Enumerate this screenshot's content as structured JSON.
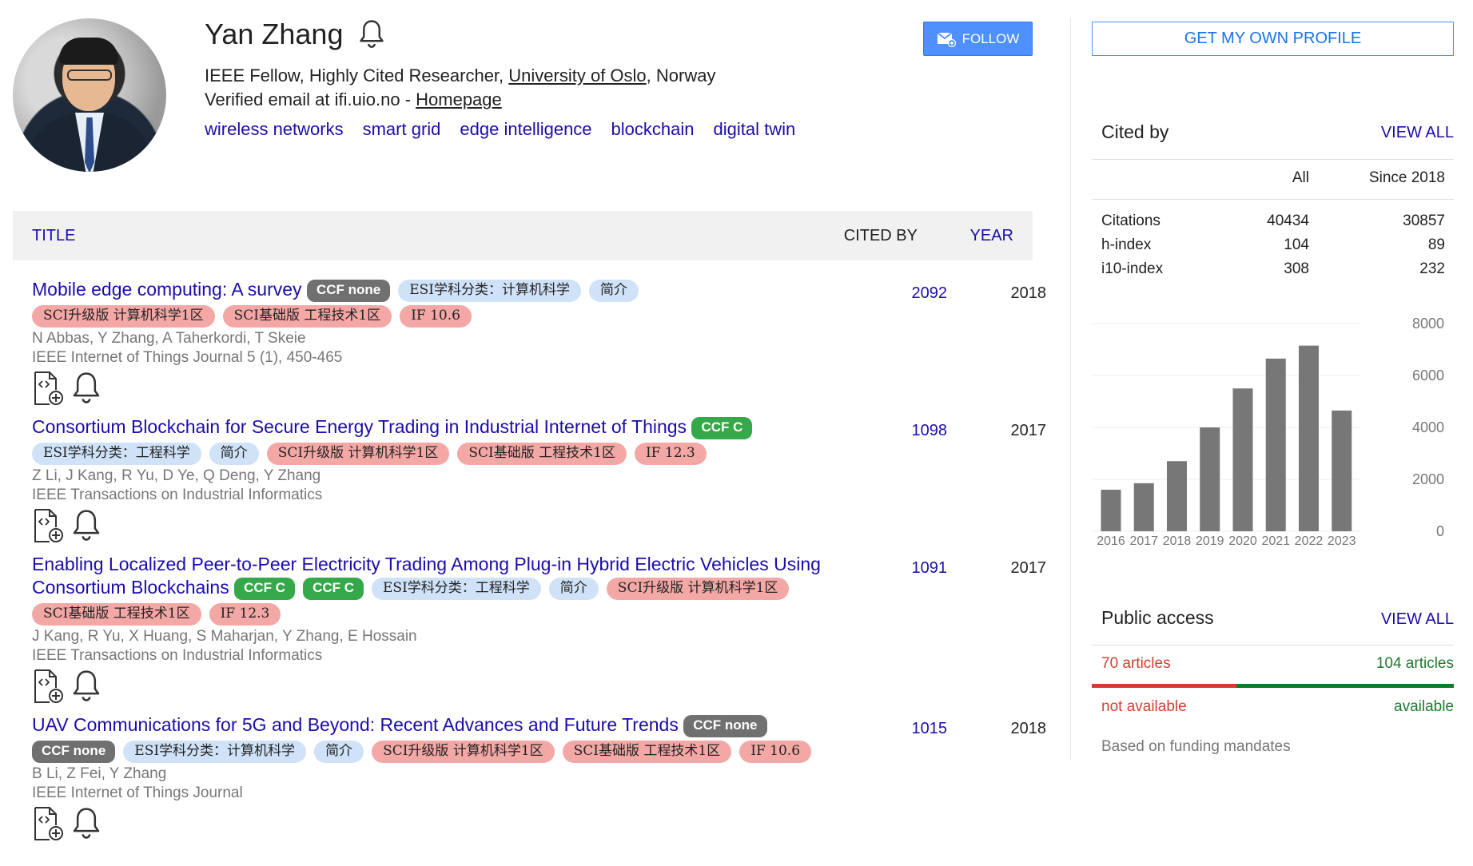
{
  "profile": {
    "name": "Yan Zhang",
    "affiliation_prefix": "IEEE Fellow, Highly Cited Researcher, ",
    "affiliation_link": "University of Oslo",
    "affiliation_suffix": ", Norway",
    "email_text": "Verified email at ifi.uio.no - ",
    "homepage_label": "Homepage",
    "interests": [
      "wireless networks",
      "smart grid",
      "edge intelligence",
      "blockchain",
      "digital twin"
    ],
    "follow_label": "FOLLOW"
  },
  "table": {
    "col_title": "TITLE",
    "col_cited": "CITED BY",
    "col_year": "YEAR"
  },
  "articles": [
    {
      "title": "Mobile edge computing: A survey",
      "tags": [
        {
          "text": "CCF none",
          "kind": "ccf-none"
        },
        {
          "text": "ESI学科分类：计算机科学",
          "kind": "blue"
        },
        {
          "text": "简介",
          "kind": "blue"
        },
        {
          "text": "SCI升级版 计算机科学1区",
          "kind": "red"
        },
        {
          "text": "SCI基础版 工程技术1区",
          "kind": "red"
        },
        {
          "text": "IF 10.6",
          "kind": "red"
        }
      ],
      "authors": "N Abbas, Y Zhang, A Taherkordi, T Skeie",
      "venue": "IEEE Internet of Things Journal 5 (1), 450-465",
      "cited_by": "2092",
      "year": "2018"
    },
    {
      "title": "Consortium Blockchain for Secure Energy Trading in Industrial Internet of Things",
      "tags": [
        {
          "text": "CCF C",
          "kind": "ccf-c"
        },
        {
          "text": "ESI学科分类：工程科学",
          "kind": "blue"
        },
        {
          "text": "简介",
          "kind": "blue"
        },
        {
          "text": "SCI升级版 计算机科学1区",
          "kind": "red"
        },
        {
          "text": "SCI基础版 工程技术1区",
          "kind": "red"
        },
        {
          "text": "IF 12.3",
          "kind": "red"
        }
      ],
      "authors": "Z Li, J Kang, R Yu, D Ye, Q Deng, Y Zhang",
      "venue": "IEEE Transactions on Industrial Informatics",
      "cited_by": "1098",
      "year": "2017"
    },
    {
      "title": "Enabling Localized Peer-to-Peer Electricity Trading Among Plug-in Hybrid Electric Vehicles Using Consortium Blockchains",
      "tags": [
        {
          "text": "CCF C",
          "kind": "ccf-c"
        },
        {
          "text": "CCF C",
          "kind": "ccf-c"
        },
        {
          "text": "ESI学科分类：工程科学",
          "kind": "blue"
        },
        {
          "text": "简介",
          "kind": "blue"
        },
        {
          "text": "SCI升级版 计算机科学1区",
          "kind": "red"
        },
        {
          "text": "SCI基础版 工程技术1区",
          "kind": "red"
        },
        {
          "text": "IF 12.3",
          "kind": "red"
        }
      ],
      "authors": "J Kang, R Yu, X Huang, S Maharjan, Y Zhang, E Hossain",
      "venue": "IEEE Transactions on Industrial Informatics",
      "cited_by": "1091",
      "year": "2017"
    },
    {
      "title": "UAV Communications for 5G and Beyond: Recent Advances and Future Trends",
      "tags": [
        {
          "text": "CCF none",
          "kind": "ccf-none"
        },
        {
          "text": "CCF none",
          "kind": "ccf-none"
        },
        {
          "text": "ESI学科分类：计算机科学",
          "kind": "blue"
        },
        {
          "text": "简介",
          "kind": "blue"
        },
        {
          "text": "SCI升级版 计算机科学1区",
          "kind": "red"
        },
        {
          "text": "SCI基础版 工程技术1区",
          "kind": "red"
        },
        {
          "text": "IF 10.6",
          "kind": "red"
        }
      ],
      "authors": "B Li, Z Fei, Y Zhang",
      "venue": "IEEE Internet of Things Journal",
      "cited_by": "1015",
      "year": "2018"
    }
  ],
  "sidebar": {
    "get_profile_label": "GET MY OWN PROFILE",
    "cited_by_title": "Cited by",
    "view_all_label": "VIEW ALL",
    "col_all": "All",
    "col_since": "Since 2018",
    "stats": [
      {
        "label": "Citations",
        "all": "40434",
        "since": "30857"
      },
      {
        "label": "h-index",
        "all": "104",
        "since": "89"
      },
      {
        "label": "i10-index",
        "all": "308",
        "since": "232"
      }
    ],
    "public_access_title": "Public access",
    "pa_not_available_count": "70 articles",
    "pa_available_count": "104 articles",
    "pa_not_available_label": "not available",
    "pa_available_label": "available",
    "pa_note": "Based on funding mandates",
    "pa_available_fraction": 0.6
  },
  "chart_data": {
    "type": "bar",
    "categories": [
      "2016",
      "2017",
      "2018",
      "2019",
      "2020",
      "2021",
      "2022",
      "2023"
    ],
    "values": [
      1600,
      1850,
      2700,
      4000,
      5500,
      6650,
      7150,
      4650
    ],
    "ylim": [
      0,
      8000
    ],
    "yticks": [
      0,
      2000,
      4000,
      6000,
      8000
    ],
    "bar_color": "#777777",
    "grid": true
  },
  "colors": {
    "link": "#1a0dab",
    "follow_bg": "#4d90fe",
    "pa_red": "#d73a30",
    "pa_green": "#0b7c28"
  }
}
